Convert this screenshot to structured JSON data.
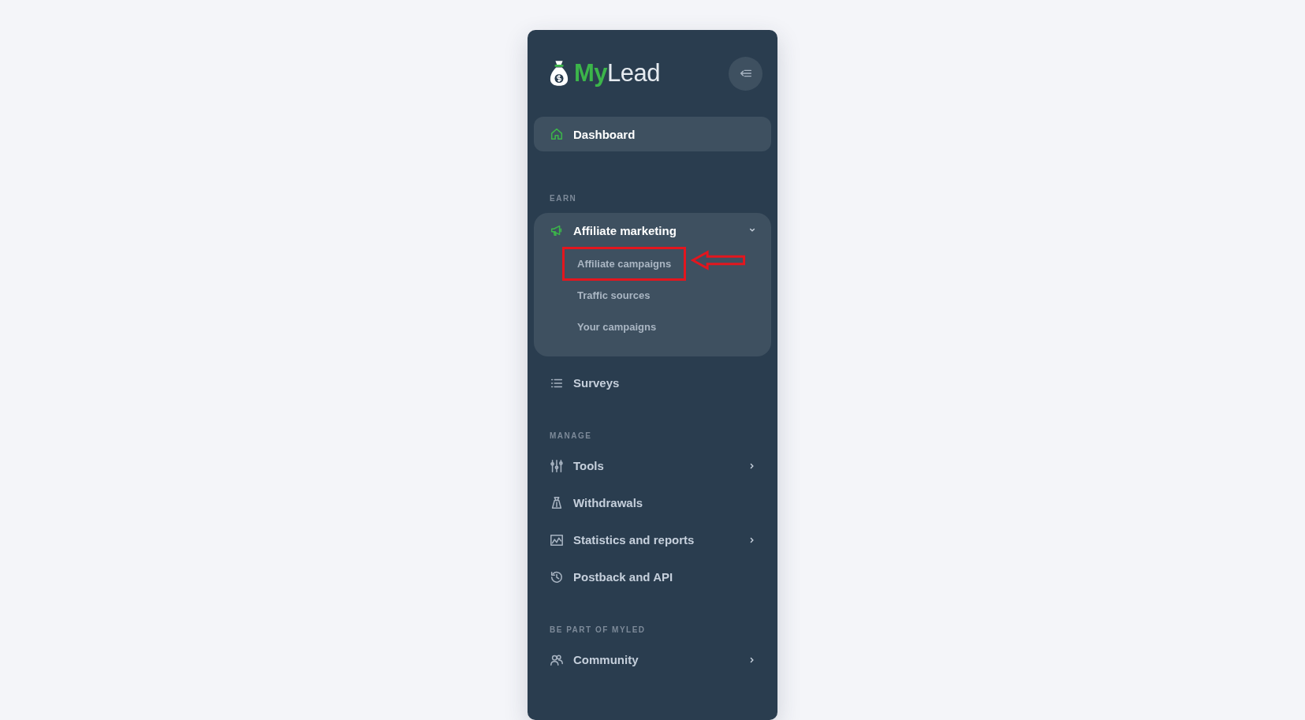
{
  "brand": {
    "name_part_1": "My",
    "name_part_2": "Lead"
  },
  "top_item": {
    "label": "Dashboard",
    "selected": true
  },
  "sections": [
    {
      "heading": "EARN",
      "items": [
        {
          "label": "Affiliate marketing",
          "kind": "group",
          "selected": false,
          "expanded": true,
          "children": [
            {
              "label": "Affiliate campaigns",
              "selected": false,
              "annotated": true
            },
            {
              "label": "Traffic sources",
              "selected": false,
              "annotated": false
            },
            {
              "label": "Your campaigns",
              "selected": false,
              "annotated": false
            }
          ]
        },
        {
          "label": "Surveys",
          "kind": "link",
          "selected": false,
          "has_submenu": false
        }
      ]
    },
    {
      "heading": "MANAGE",
      "items": [
        {
          "label": "Tools",
          "kind": "link",
          "selected": false,
          "has_submenu": true
        },
        {
          "label": "Withdrawals",
          "kind": "link",
          "selected": false,
          "has_submenu": false
        },
        {
          "label": "Statistics and reports",
          "kind": "link",
          "selected": false,
          "has_submenu": true
        },
        {
          "label": "Postback and API",
          "kind": "link",
          "selected": false,
          "has_submenu": false
        }
      ]
    },
    {
      "heading": "BE PART OF MYLED",
      "items": [
        {
          "label": "Community",
          "kind": "link",
          "selected": false,
          "has_submenu": true
        }
      ]
    }
  ]
}
